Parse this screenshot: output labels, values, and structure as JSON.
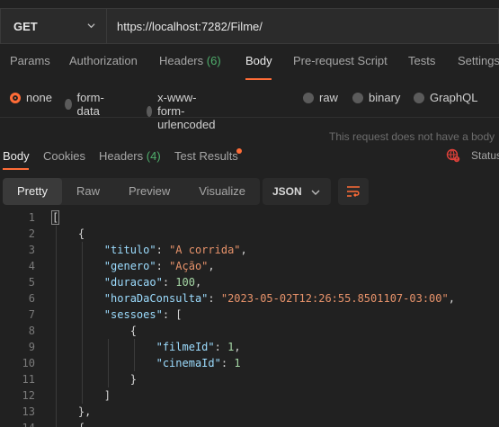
{
  "request": {
    "method": "GET",
    "url": "https://localhost:7282/Filme/"
  },
  "request_tabs": [
    {
      "label": "Params",
      "count": ""
    },
    {
      "label": "Authorization",
      "count": ""
    },
    {
      "label": "Headers",
      "count": "(6)"
    },
    {
      "label": "Body",
      "count": ""
    },
    {
      "label": "Pre-request Script",
      "count": ""
    },
    {
      "label": "Tests",
      "count": ""
    },
    {
      "label": "Settings",
      "count": ""
    }
  ],
  "body_types": [
    "none",
    "form-data",
    "x-www-form-urlencoded",
    "raw",
    "binary",
    "GraphQL"
  ],
  "hint_text": "This request does not have a body",
  "response_tabs": [
    {
      "label": "Body",
      "count": ""
    },
    {
      "label": "Cookies",
      "count": ""
    },
    {
      "label": "Headers",
      "count": "(4)"
    },
    {
      "label": "Test Results",
      "count": ""
    }
  ],
  "status_label": "Status",
  "format_options": [
    "Pretty",
    "Raw",
    "Preview",
    "Visualize"
  ],
  "language": "JSON",
  "code_lines": [
    {
      "n": "1",
      "t": "["
    },
    {
      "n": "2",
      "t": "    {"
    },
    {
      "n": "3",
      "t": "        \"titulo\": \"A corrida\","
    },
    {
      "n": "4",
      "t": "        \"genero\": \"Ação\","
    },
    {
      "n": "5",
      "t": "        \"duracao\": 100,"
    },
    {
      "n": "6",
      "t": "        \"horaDaConsulta\": \"2023-05-02T12:26:55.8501107-03:00\","
    },
    {
      "n": "7",
      "t": "        \"sessoes\": ["
    },
    {
      "n": "8",
      "t": "            {"
    },
    {
      "n": "9",
      "t": "                \"filmeId\": 1,"
    },
    {
      "n": "10",
      "t": "                \"cinemaId\": 1"
    },
    {
      "n": "11",
      "t": "            }"
    },
    {
      "n": "12",
      "t": "        ]"
    },
    {
      "n": "13",
      "t": "    },"
    },
    {
      "n": "14",
      "t": "    {"
    }
  ],
  "colors": {
    "accent": "#ff6c37",
    "count_green": "#4fae6c",
    "json_key": "#9cdcfe",
    "json_string": "#e8936b",
    "json_number": "#a6d8a6",
    "error_red": "#e0413a"
  }
}
